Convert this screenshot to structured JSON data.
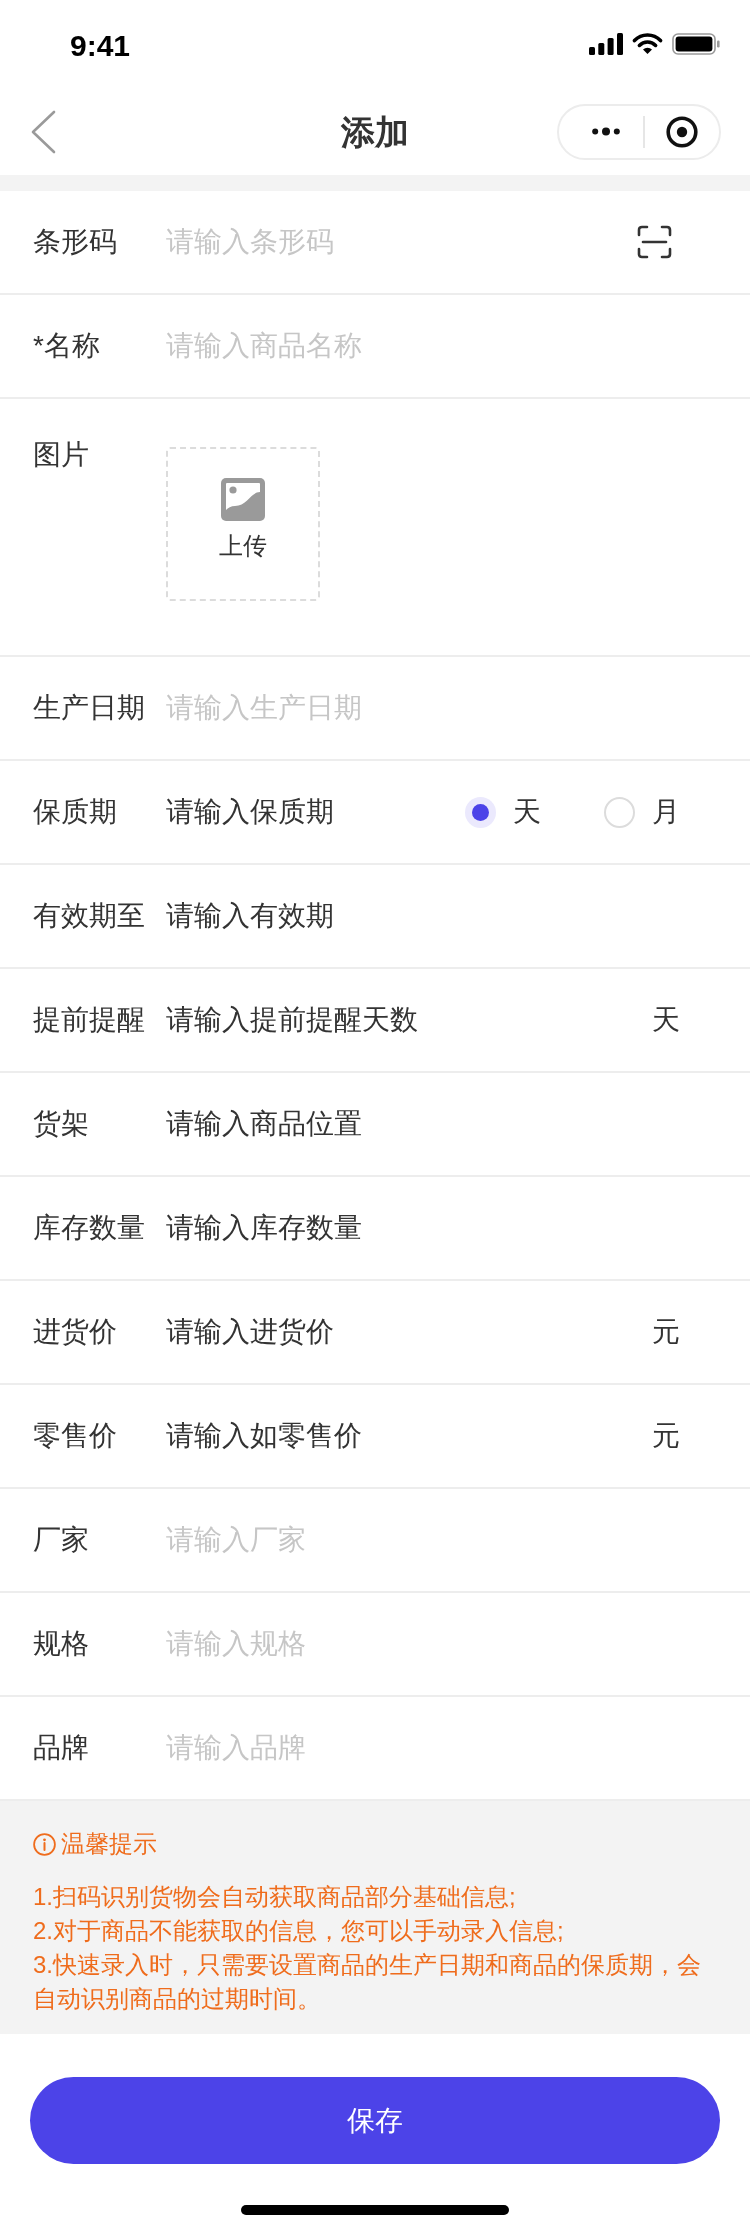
{
  "status_bar": {
    "time": "9:41"
  },
  "nav_bar": {
    "title": "添加"
  },
  "form": {
    "fields": [
      {
        "kind": "scan",
        "label": "条形码",
        "placeholder": "请输入条形码",
        "dimmed": true
      },
      {
        "kind": "input",
        "label": "*名称",
        "placeholder": "请输入商品名称",
        "dimmed": true
      },
      {
        "kind": "upload",
        "label": "图片",
        "upload_label": "上传"
      },
      {
        "kind": "input",
        "label": "生产日期",
        "placeholder": "请输入生产日期",
        "dimmed": true
      },
      {
        "kind": "radio",
        "label": "保质期",
        "placeholder": "请输入保质期",
        "dimmed": false,
        "options": [
          {
            "label": "天",
            "selected": true
          },
          {
            "label": "月",
            "selected": false
          }
        ]
      },
      {
        "kind": "input",
        "label": "有效期至",
        "placeholder": "请输入有效期",
        "dimmed": false
      },
      {
        "kind": "unit",
        "label": "提前提醒",
        "placeholder": "请输入提前提醒天数",
        "dimmed": false,
        "unit": "天"
      },
      {
        "kind": "input",
        "label": "货架",
        "placeholder": "请输入商品位置",
        "dimmed": false
      },
      {
        "kind": "input",
        "label": "库存数量",
        "placeholder": "请输入库存数量",
        "dimmed": false
      },
      {
        "kind": "unit",
        "label": "进货价",
        "placeholder": "请输入进货价",
        "dimmed": false,
        "unit": "元"
      },
      {
        "kind": "unit",
        "label": "零售价",
        "placeholder": "请输入如零售价",
        "dimmed": false,
        "unit": "元"
      },
      {
        "kind": "input",
        "label": "厂家",
        "placeholder": "请输入厂家",
        "dimmed": true
      },
      {
        "kind": "input",
        "label": "规格",
        "placeholder": "请输入规格",
        "dimmed": true
      },
      {
        "kind": "input",
        "label": "品牌",
        "placeholder": "请输入品牌",
        "dimmed": true
      }
    ]
  },
  "tips": {
    "title": "温馨提示",
    "items": [
      "1.扫码识别货物会自动获取商品部分基础信息;",
      "2.对于商品不能获取的信息，您可以手动录入信息;",
      "3.快速录入时，只需要设置商品的生产日期和商品的保质期，会自动识别商品的过期时间。"
    ]
  },
  "save_button": {
    "label": "保存"
  }
}
